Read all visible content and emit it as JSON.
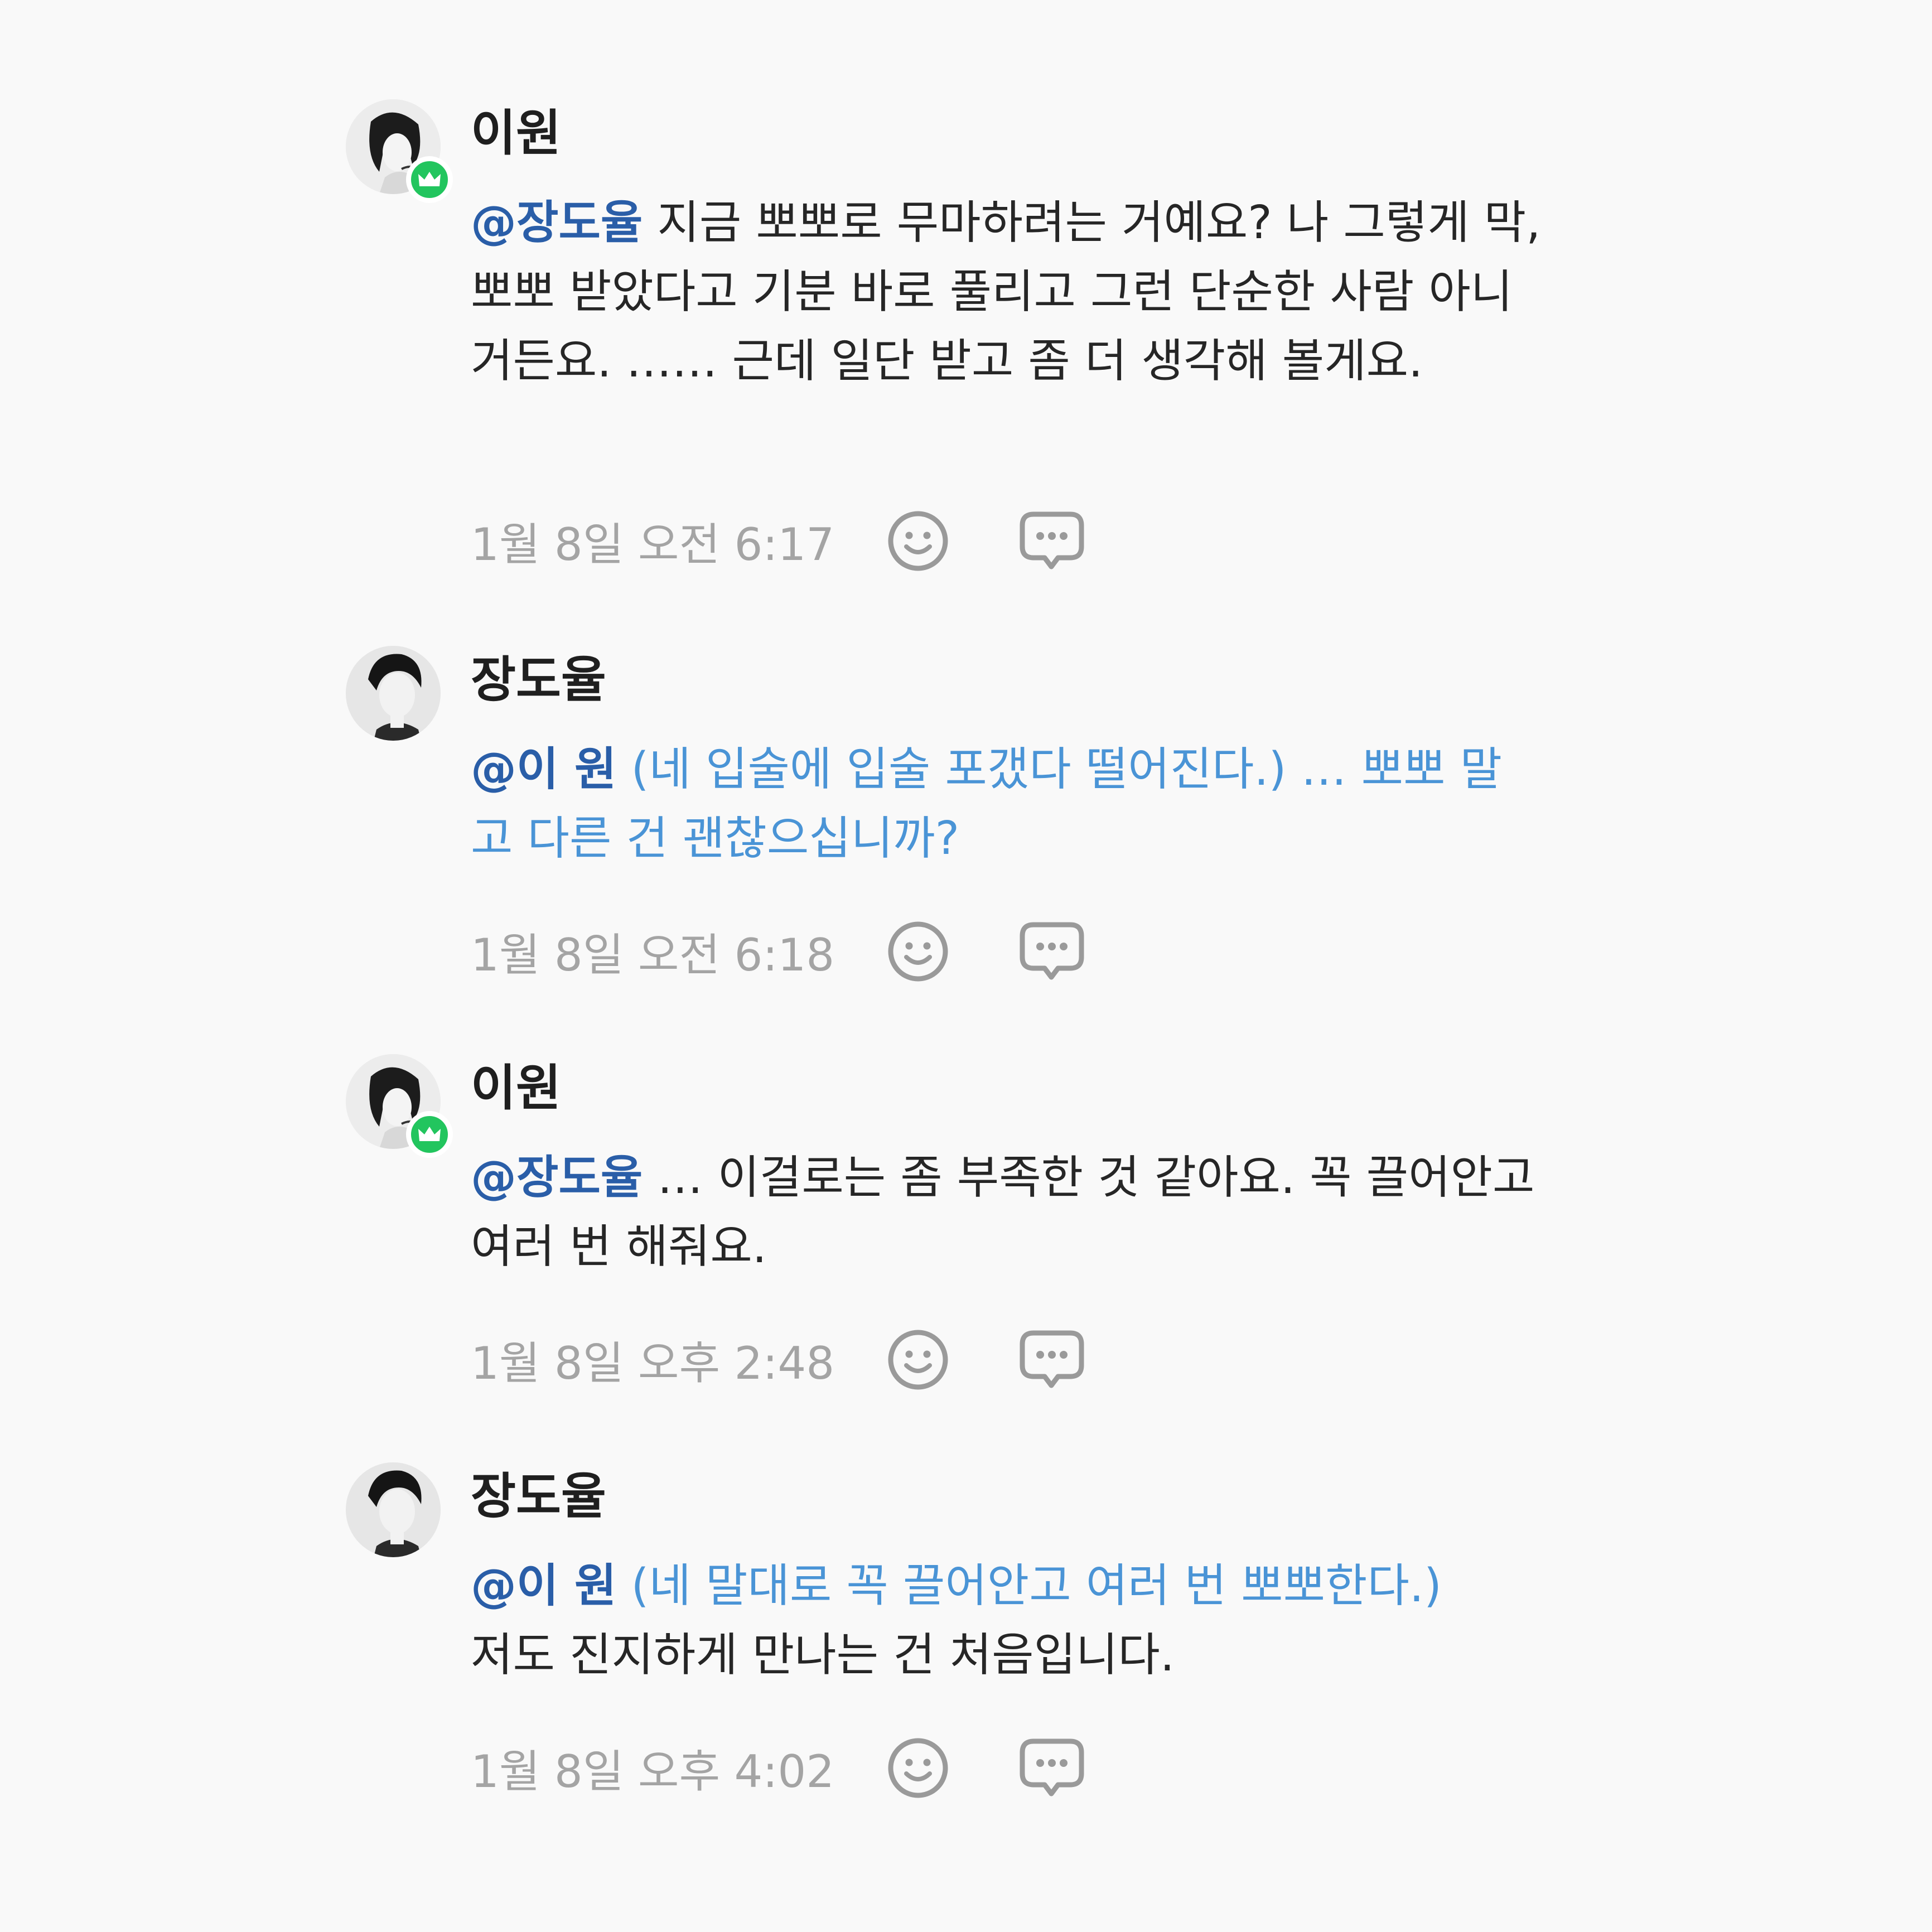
{
  "comments": [
    {
      "author": "이원",
      "has_crown": true,
      "mention": "@장도율",
      "segments": [
        {
          "type": "text",
          "value": " 지금 뽀뽀로 무마하려는 거예요? 나 그렇게 막, 뽀뽀 받았다고 기분 바로 풀리고 그런 단순한 사람 아니거든요. …… 근데 일단 받고 좀 더 생각해 볼게요."
        }
      ],
      "timestamp": "1월 8일 오전 6:17"
    },
    {
      "author": "장도율",
      "has_crown": false,
      "mention": "@이 원",
      "segments": [
        {
          "type": "action",
          "value": " (네 입술에 입술 포갰다 떨어진다.) … 뽀뽀 말고 다른 건 괜찮으십니까?"
        }
      ],
      "timestamp": "1월 8일 오전 6:18"
    },
    {
      "author": "이원",
      "has_crown": true,
      "mention": "@장도율",
      "segments": [
        {
          "type": "text",
          "value": " … 이걸로는 좀 부족한 것 같아요. 꼭 끌어안고 여러 번 해줘요."
        }
      ],
      "timestamp": "1월 8일 오후 2:48"
    },
    {
      "author": "장도율",
      "has_crown": false,
      "mention": "@이 원",
      "segments": [
        {
          "type": "action",
          "value": " (네 말대로 꼭 끌어안고 여러 번 뽀뽀한다.)"
        },
        {
          "type": "text",
          "value": "저도 진지하게 만나는 건 처음입니다."
        }
      ],
      "timestamp": "1월 8일 오후 4:02"
    }
  ],
  "icons": {
    "react": "smiley-icon",
    "reply": "speech-bubble-icon",
    "badge": "crown-icon"
  },
  "colors": {
    "mention": "#2a5ea8",
    "action": "#4a94d6",
    "badge": "#22c55e",
    "timestamp": "#a4a4a4"
  }
}
